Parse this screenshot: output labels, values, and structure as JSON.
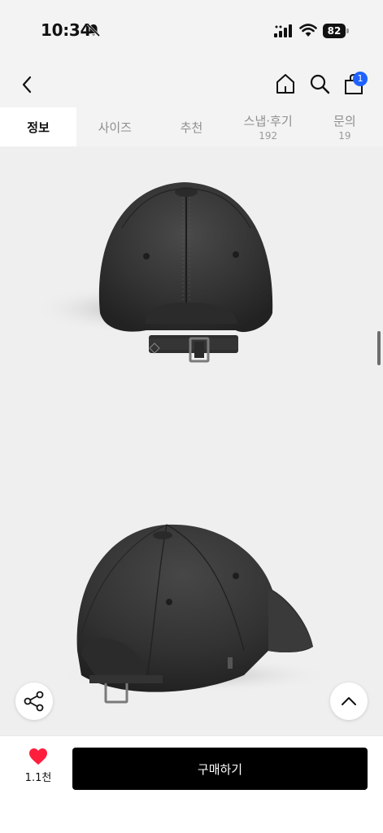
{
  "status": {
    "time": "10:34",
    "battery": "82"
  },
  "nav": {
    "cart_count": "1"
  },
  "tabs": [
    {
      "label": "정보",
      "count": ""
    },
    {
      "label": "사이즈",
      "count": ""
    },
    {
      "label": "추천",
      "count": ""
    },
    {
      "label": "스냅·후기",
      "count": "192"
    },
    {
      "label": "문의",
      "count": "19"
    }
  ],
  "product": {
    "images": [
      "black-denim-cap-back-view",
      "black-denim-cap-rear-angle-view"
    ]
  },
  "bottom": {
    "like_count": "1.1천",
    "buy_label": "구매하기"
  },
  "colors": {
    "accent": "#1e63ff",
    "heart": "#ff1f3d",
    "buy_button": "#000000"
  }
}
